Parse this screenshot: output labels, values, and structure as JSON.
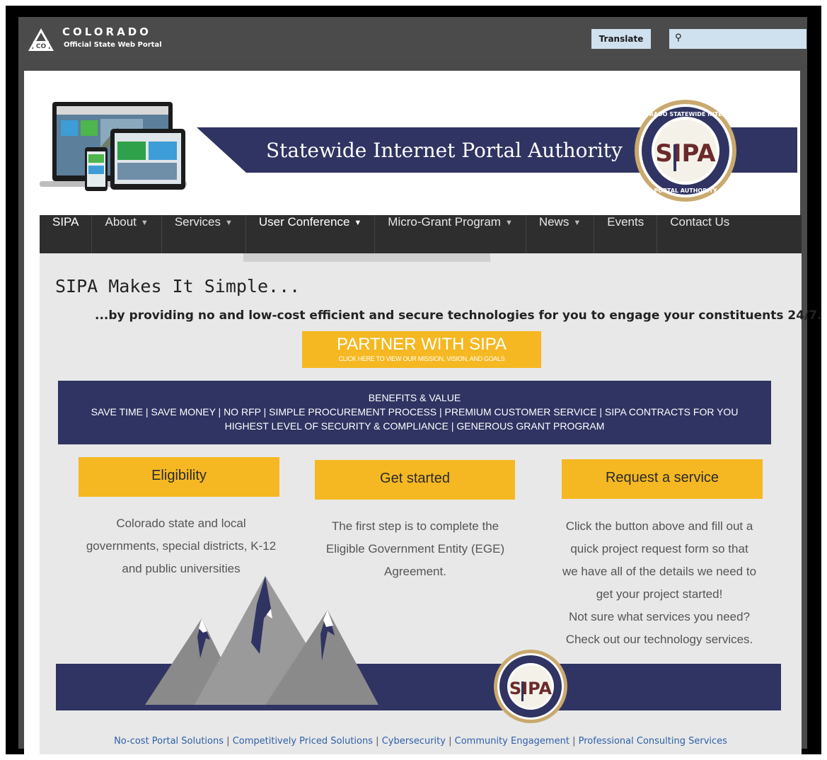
{
  "topbar": {
    "state_name": "COLORADO",
    "subtitle": "Official State Web Portal",
    "logo_text": "CO",
    "translate_label": "Translate",
    "search_placeholder": ""
  },
  "header": {
    "title": "Statewide Internet Portal Authority",
    "seal_text_top": "COLORADO STATEWIDE INTERNET",
    "seal_text_bottom": "PORTAL AUTHORITY",
    "seal_logo": "SIPA"
  },
  "nav": {
    "items": [
      {
        "label": "SIPA",
        "dropdown": false
      },
      {
        "label": "About",
        "dropdown": true
      },
      {
        "label": "Services",
        "dropdown": true
      },
      {
        "label": "User Conference",
        "dropdown": true
      },
      {
        "label": "Micro-Grant Program",
        "dropdown": true
      },
      {
        "label": "News",
        "dropdown": true
      },
      {
        "label": "Events",
        "dropdown": false
      },
      {
        "label": "Contact Us",
        "dropdown": false
      }
    ]
  },
  "main": {
    "heading": "SIPA Makes It Simple...",
    "tagline": "...by providing no and low-cost efficient and secure technologies for you to engage your constituents 24/7.",
    "partner": {
      "title": "PARTNER WITH SIPA",
      "subtitle": "CLICK HERE TO VIEW OUR MISSION, VISION, AND GOALS"
    },
    "benefits": {
      "title": "BENEFITS & VALUE",
      "line1": "SAVE TIME | SAVE MONEY | NO RFP | SIMPLE PROCUREMENT PROCESS | PREMIUM CUSTOMER SERVICE |  SIPA CONTRACTS FOR YOU",
      "line2": "HIGHEST LEVEL OF SECURITY & COMPLIANCE | GENEROUS GRANT PROGRAM"
    },
    "columns": [
      {
        "button": "Eligibility",
        "lines": [
          "Colorado state and local",
          "governments, special districts, K-12",
          "and public universities"
        ]
      },
      {
        "button": "Get started",
        "lines": [
          "The first step is to complete the",
          "Eligible Government Entity (EGE)",
          "Agreement."
        ]
      },
      {
        "button": "Request a service",
        "lines": [
          "Click the button above and fill out a",
          "quick project request form so that",
          "we have all of the details we need to",
          "get your project started!",
          "Not sure what services you need?",
          "Check out our technology services."
        ]
      }
    ]
  },
  "footer": {
    "links": [
      "No-cost Portal Solutions",
      "Competitively Priced Solutions",
      "Cybersecurity",
      "Community Engagement",
      "Professional Consulting Services"
    ],
    "separator": "|"
  },
  "colors": {
    "navy": "#2f3462",
    "gold": "#f5b822",
    "nav_bg": "#2e2e2e",
    "topbar_bg": "#4b4b4b",
    "link": "#2e5fa8"
  },
  "icons": {
    "logo": "colorado-mountain-logo-icon",
    "search": "search-icon",
    "caret": "chevron-down-icon"
  }
}
